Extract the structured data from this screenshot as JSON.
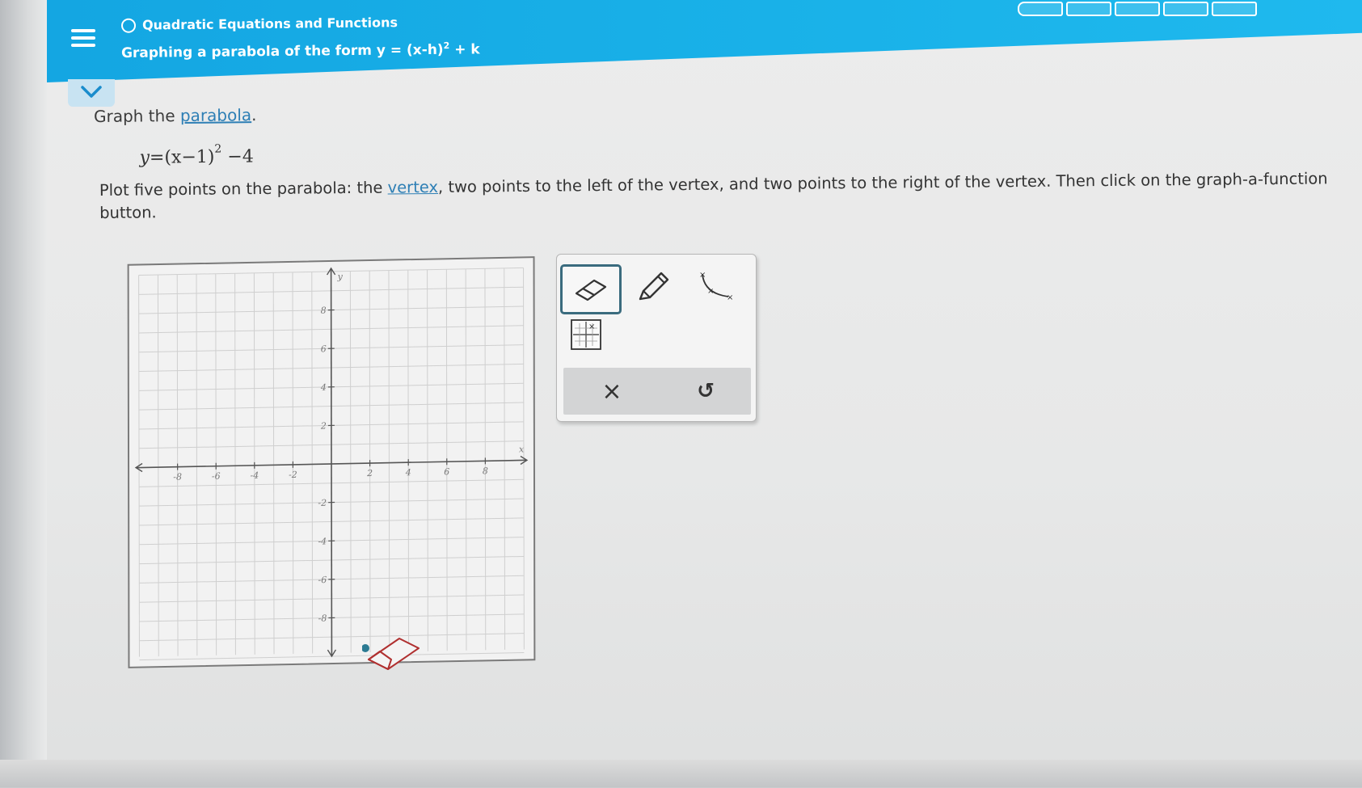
{
  "header": {
    "topic": "Quadratic Equations and Functions",
    "lesson_prefix": "Graphing a parabola of the form y = (x-h)",
    "lesson_exp": "2",
    "lesson_suffix": " + k"
  },
  "problem": {
    "prompt_prefix": "Graph the ",
    "prompt_link": "parabola",
    "prompt_suffix": ".",
    "equation_lhs": "y=",
    "equation_base": "(x−1)",
    "equation_exp": "2",
    "equation_tail": " −4",
    "instr_part1": "Plot five points on the parabola: the ",
    "instr_link": "vertex",
    "instr_part2": ", two points to the left of the vertex, and two points to the right of the vertex. Then click on the graph-a-function button."
  },
  "graph": {
    "x_axis_label": "x",
    "y_axis_label": "y",
    "x_ticks": [
      "-8",
      "-6",
      "-4",
      "-2",
      "2",
      "4",
      "6",
      "8"
    ],
    "y_ticks": [
      "8",
      "6",
      "4",
      "2",
      "-2",
      "-4",
      "-6",
      "-8"
    ]
  },
  "tools": {
    "eraser": "eraser-icon",
    "pencil": "pencil-icon",
    "parabola": "parabola-tool-icon",
    "graph_function": "graph-a-function-icon",
    "clear": "×",
    "undo": "↺"
  },
  "colors": {
    "header_blue": "#19b1e8",
    "link_blue": "#2e7fb5",
    "point_teal": "#2b7a92"
  }
}
